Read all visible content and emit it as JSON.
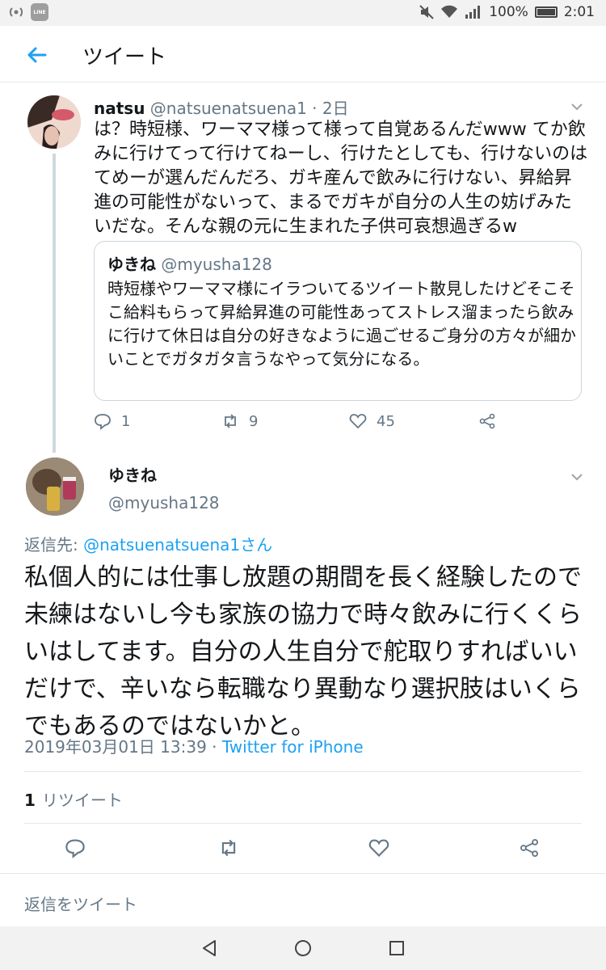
{
  "status_bar": {
    "battery": "100%",
    "time": "2:01",
    "line_badge": "LINE"
  },
  "app_bar": {
    "title": "ツイート"
  },
  "parent_tweet": {
    "name": "natsu",
    "handle": "@natsuenatsuena1",
    "age": "· 2日",
    "text": "は？時短様、ワーママ様って様って自覚あるんだwww てか飲みに行けてって行けてねーし、行けたとしても、行けないのはてめーが選んだんだろ、ガキ産んで飲みに行けない、昇給昇進の可能性がないって、まるでガキが自分の人生の妨げみたいだな。そんな親の元に生まれた子供可哀想過ぎるw",
    "quote": {
      "name": "ゆきね",
      "handle": "@myusha128",
      "text": "時短様やワーママ様にイラついてるツイート散見したけどそこそこ給料もらって昇給昇進の可能性あってストレス溜まったら飲みに行けて休日は自分の好きなように過ごせるご身分の方々が細かいことでガタガタ言うなやって気分になる。"
    },
    "replies": "1",
    "retweets": "9",
    "likes": "45"
  },
  "main_tweet": {
    "name": "ゆきね",
    "handle": "@myusha128",
    "reply_prefix": "返信先: ",
    "reply_link": "@natsuenatsuena1さん",
    "text": "私個人的には仕事し放題の期間を長く経験したので未練はないし今も家族の協力で時々飲みに行くくらいはしてます。自分の人生自分で舵取りすればいいだけで、辛いなら転職なり異動なり選択肢はいくらでもあるのではないかと。",
    "timestamp": "2019年03月01日 13:39 · ",
    "source": "Twitter for iPhone",
    "retweet_count": "1",
    "retweet_label": "リツイート"
  },
  "reply_bar": {
    "placeholder": "返信をツイート"
  },
  "icons": {
    "back": "arrow-left-icon",
    "reply": "speech-bubble-icon",
    "retweet": "retweet-icon",
    "like": "heart-icon",
    "share": "share-icon",
    "caret": "chevron-down-icon"
  },
  "colors": {
    "accent": "#1da1f2",
    "muted": "#657786",
    "text": "#14171a",
    "border": "#e1e8ed"
  }
}
